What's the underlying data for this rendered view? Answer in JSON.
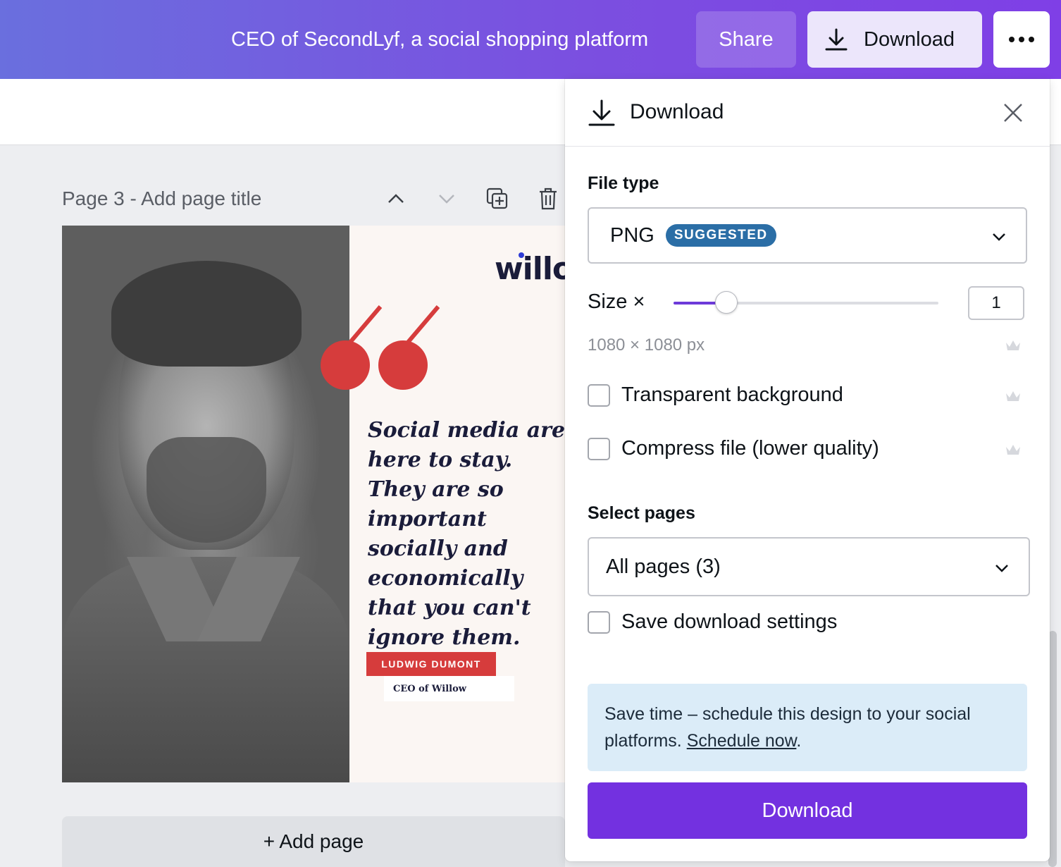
{
  "topbar": {
    "doc_title": "CEO of SecondLyf, a social shopping platform",
    "share_label": "Share",
    "download_label": "Download",
    "more_icon": "more-horizontal-icon"
  },
  "page": {
    "label": "Page 3 - Add page title",
    "add_page_label": "+ Add page"
  },
  "design": {
    "logo": "willow",
    "quote": "Social media are here to stay. They are so important socially and economically that you can't ignore them.",
    "person_name": "LUDWIG DUMONT",
    "person_role": "CEO of Willow",
    "accent_color": "#d63c3c"
  },
  "panel": {
    "title": "Download",
    "file_type_label": "File type",
    "file_type_value": "PNG",
    "file_type_badge": "SUGGESTED",
    "size_label": "Size ×",
    "size_value": "1",
    "size_slider_fraction": 0.2,
    "dimensions": "1080 × 1080 px",
    "options": [
      {
        "label": "Transparent background",
        "checked": false,
        "premium": true
      },
      {
        "label": "Compress file (lower quality)",
        "checked": false,
        "premium": true
      }
    ],
    "select_pages_label": "Select pages",
    "select_pages_value": "All pages (3)",
    "save_settings_label": "Save download settings",
    "promo_text": "Save time – schedule this design to your social platforms. ",
    "promo_link": "Schedule now",
    "promo_suffix": ".",
    "download_button": "Download"
  },
  "colors": {
    "primary": "#7331e0",
    "badge": "#2b6ea6",
    "promo_bg": "#dbecf8"
  }
}
